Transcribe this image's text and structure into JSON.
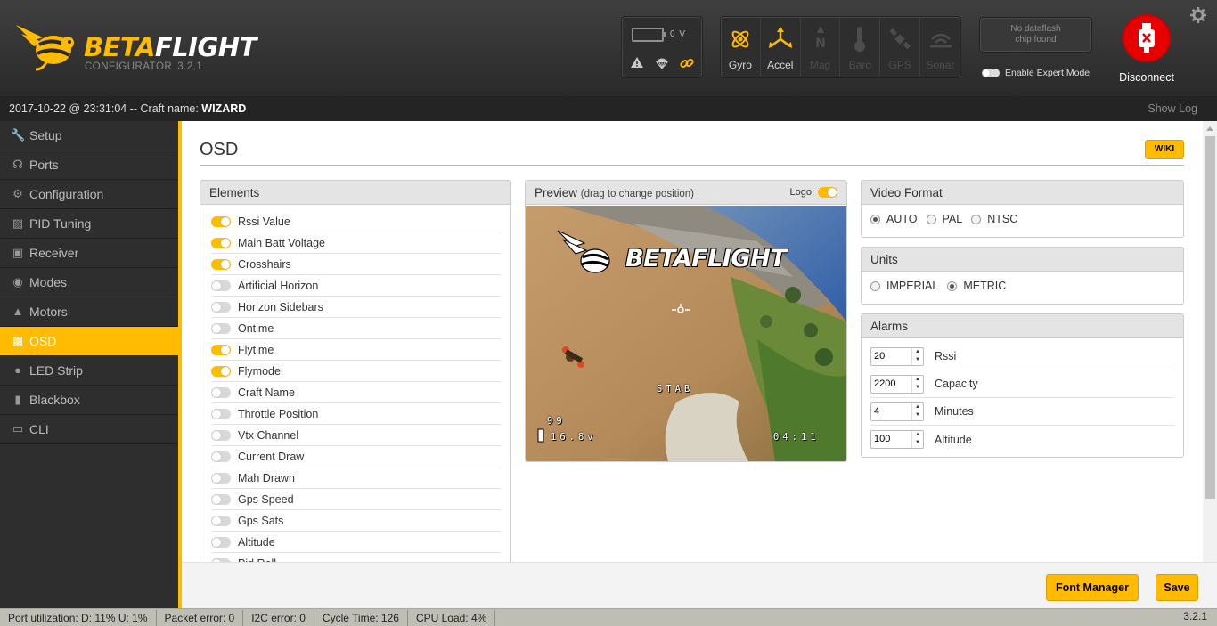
{
  "header": {
    "brand": {
      "part1": "BETA",
      "part2": "FLIGHT"
    },
    "subtitle": "CONFIGURATOR",
    "app_version": "3.2.1",
    "battery_voltage": "0 V",
    "sensors": [
      {
        "label": "Gyro",
        "icon": "gyro-icon",
        "active": true
      },
      {
        "label": "Accel",
        "icon": "accel-icon",
        "active": true
      },
      {
        "label": "Mag",
        "icon": "mag-icon",
        "active": false
      },
      {
        "label": "Baro",
        "icon": "baro-icon",
        "active": false
      },
      {
        "label": "GPS",
        "icon": "gps-icon",
        "active": false
      },
      {
        "label": "Sonar",
        "icon": "sonar-icon",
        "active": false
      }
    ],
    "dataflash": {
      "line1": "No dataflash",
      "line2": "chip found"
    },
    "expert_mode_label": "Enable Expert Mode",
    "disconnect_label": "Disconnect"
  },
  "logbar": {
    "timestamp": "2017-10-22 @ 23:31:04 -- Craft name: ",
    "craft_name": "WIZARD",
    "show_log": "Show Log"
  },
  "sidebar": {
    "items": [
      {
        "label": "Setup",
        "icon": "wrench-icon"
      },
      {
        "label": "Ports",
        "icon": "plug-icon"
      },
      {
        "label": "Configuration",
        "icon": "gear-icon"
      },
      {
        "label": "PID Tuning",
        "icon": "sitemap-icon"
      },
      {
        "label": "Receiver",
        "icon": "receiver-icon"
      },
      {
        "label": "Modes",
        "icon": "modes-icon"
      },
      {
        "label": "Motors",
        "icon": "motor-icon"
      },
      {
        "label": "OSD",
        "icon": "osd-icon",
        "active": true
      },
      {
        "label": "LED Strip",
        "icon": "led-icon"
      },
      {
        "label": "Blackbox",
        "icon": "blackbox-icon"
      },
      {
        "label": "CLI",
        "icon": "terminal-icon"
      }
    ]
  },
  "page": {
    "title": "OSD",
    "wiki": "WIKI"
  },
  "elements": {
    "title": "Elements",
    "items": [
      {
        "label": "Rssi Value",
        "on": true
      },
      {
        "label": "Main Batt Voltage",
        "on": true
      },
      {
        "label": "Crosshairs",
        "on": true
      },
      {
        "label": "Artificial Horizon",
        "on": false
      },
      {
        "label": "Horizon Sidebars",
        "on": false
      },
      {
        "label": "Ontime",
        "on": false
      },
      {
        "label": "Flytime",
        "on": true
      },
      {
        "label": "Flymode",
        "on": true
      },
      {
        "label": "Craft Name",
        "on": false
      },
      {
        "label": "Throttle Position",
        "on": false
      },
      {
        "label": "Vtx Channel",
        "on": false
      },
      {
        "label": "Current Draw",
        "on": false
      },
      {
        "label": "Mah Drawn",
        "on": false
      },
      {
        "label": "Gps Speed",
        "on": false
      },
      {
        "label": "Gps Sats",
        "on": false
      },
      {
        "label": "Altitude",
        "on": false
      },
      {
        "label": "Pid Roll",
        "on": false
      }
    ]
  },
  "preview": {
    "title": "Preview",
    "hint": "(drag to change position)",
    "logo_label": "Logo:",
    "logo_on": true,
    "osd": {
      "logo": "BETAFLIGHT",
      "mode": "STAB",
      "rssi": "99",
      "voltage": "16.8v",
      "flytime": "04:11"
    }
  },
  "video_format": {
    "title": "Video Format",
    "options": [
      "AUTO",
      "PAL",
      "NTSC"
    ],
    "selected": "AUTO"
  },
  "units": {
    "title": "Units",
    "options": [
      "IMPERIAL",
      "METRIC"
    ],
    "selected": "METRIC"
  },
  "alarms": {
    "title": "Alarms",
    "items": [
      {
        "value": "20",
        "label": "Rssi"
      },
      {
        "value": "2200",
        "label": "Capacity"
      },
      {
        "value": "4",
        "label": "Minutes"
      },
      {
        "value": "100",
        "label": "Altitude"
      }
    ]
  },
  "footer": {
    "font_manager": "Font Manager",
    "save": "Save"
  },
  "statusbar": {
    "port_util": "Port utilization: D: 11% U: 1%",
    "packet_error": "Packet error: 0",
    "i2c_error": "I2C error: 0",
    "cycle_time": "Cycle Time: 126",
    "cpu_load": "CPU Load: 4%",
    "version": "3.2.1"
  },
  "colors": {
    "accent": "#ffbb00",
    "header_bg": "#333333",
    "sidebar_bg": "#2e2e2e",
    "disconnect_red": "#e60000"
  }
}
